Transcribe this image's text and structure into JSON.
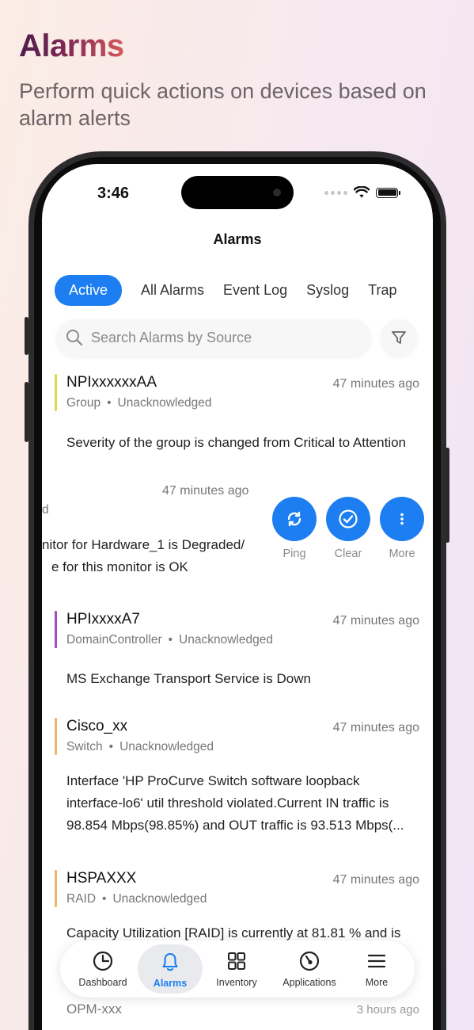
{
  "promo": {
    "title": "Alarms",
    "subtitle": "Perform quick actions on devices based on alarm alerts"
  },
  "status_bar": {
    "time": "3:46"
  },
  "screen_title": "Alarms",
  "tabs": [
    {
      "label": "Active",
      "active": true
    },
    {
      "label": "All Alarms"
    },
    {
      "label": "Event Log"
    },
    {
      "label": "Syslog"
    },
    {
      "label": "Trap"
    }
  ],
  "search": {
    "placeholder": "Search Alarms by Source"
  },
  "alarms": [
    {
      "name": "NPIxxxxxxAA",
      "time": "47 minutes ago",
      "category": "Group",
      "status": "Unacknowledged",
      "message": "Severity of the group is changed from Critical to Attention",
      "severity_color": "#dfd84a"
    },
    {
      "name": "HPIxxxxA7",
      "time": "47 minutes ago",
      "category": "DomainController",
      "status": "Unacknowledged",
      "message": "MS Exchange Transport Service is Down",
      "severity_color": "#a24fbf"
    },
    {
      "name": "Cisco_xx",
      "time": "47 minutes ago",
      "category": "Switch",
      "status": "Unacknowledged",
      "message": "Interface 'HP ProCurve Switch software loopback interface-lo6'  util threshold violated.Current IN traffic is 98.854 Mbps(98.85%) and OUT traffic is 93.513 Mbps(...",
      "severity_color": "#f0b56a"
    },
    {
      "name": "HSPAXXX",
      "time": "47 minutes ago",
      "category": "RAID",
      "status": "Unacknowledged",
      "message": "Capacity Utilization [RAID] is currently at 81.81 % and is",
      "severity_color": "#f0b56a"
    }
  ],
  "swiped_alarm": {
    "time": "47 minutes ago",
    "status_fragment": "d",
    "message_line1": "nitor for Hardware_1 is Degraded/",
    "message_line2": "e for this monitor is OK"
  },
  "actions": [
    {
      "label": "Ping",
      "icon": "refresh-icon"
    },
    {
      "label": "Clear",
      "icon": "check-circle-icon"
    },
    {
      "label": "More",
      "icon": "more-vertical-icon"
    }
  ],
  "peek_alarm": {
    "name": "OPM-xxx",
    "time": "3 hours ago"
  },
  "tabbar": [
    {
      "label": "Dashboard",
      "icon": "dashboard-icon"
    },
    {
      "label": "Alarms",
      "icon": "bell-icon",
      "active": true
    },
    {
      "label": "Inventory",
      "icon": "grid-icon"
    },
    {
      "label": "Applications",
      "icon": "applications-icon"
    },
    {
      "label": "More",
      "icon": "menu-icon"
    }
  ],
  "colors": {
    "accent": "#1c7ef0"
  }
}
